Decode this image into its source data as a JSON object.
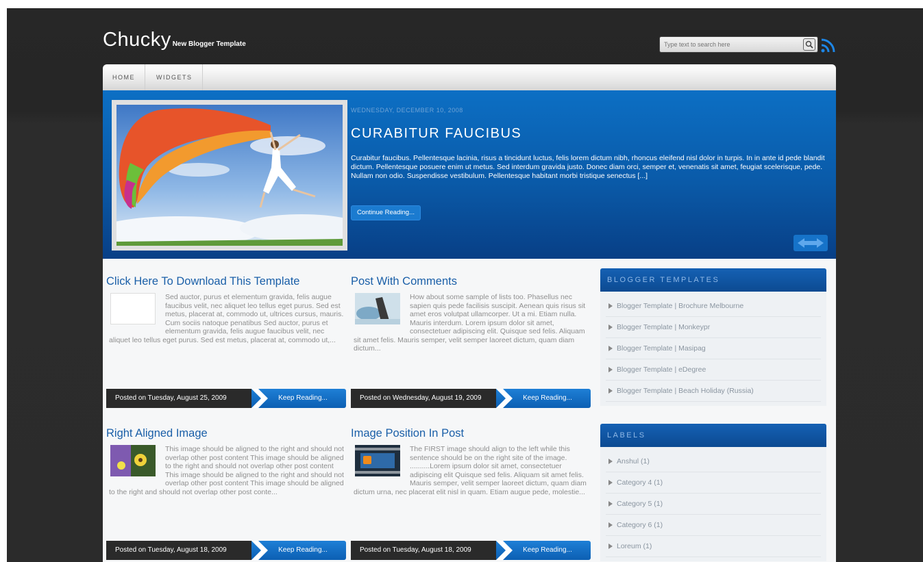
{
  "header": {
    "site_title": "Chucky",
    "tagline": "New Blogger Template",
    "search_placeholder": "Type text to search here",
    "rss_icon": "rss-icon"
  },
  "nav": {
    "items": [
      {
        "label": "HOME"
      },
      {
        "label": "WIDGETS"
      }
    ]
  },
  "featured": {
    "date": "WEDNESDAY, DECEMBER 10, 2008",
    "title": "CURABITUR FAUCIBUS",
    "text": "Curabitur faucibus. Pellentesque lacinia, risus a tincidunt luctus, felis lorem dictum nibh, rhoncus eleifend nisl dolor in turpis. In in ante id pede blandit dictum. Pellentesque posuere enim ut metus. Sed interdum gravida justo. Donec diam orci, semper et, venenatis sit amet, feugiat scelerisque, pede. Nullam non odio. Suspendisse vestibulum. Pellentesque habitant morbi tristique senectus [...]",
    "button": "Continue Reading...",
    "arrows_icon": "slider-arrows-icon",
    "colors": {
      "accent": "#0a5aa8",
      "title": "#ffffff"
    }
  },
  "posts": [
    {
      "title": "Click Here To Download This Template",
      "body": "Sed auctor, purus et elementum gravida, felis augue faucibus velit, nec aliquet leo tellus eget purus. Sed est metus, placerat at, commodo ut, ultrices cursus, mauris. Cum sociis natoque penatibus Sed auctor, purus et elementum gravida, felis augue faucibus velit, nec aliquet leo tellus eget purus. Sed est metus, placerat at, commodo ut,...",
      "meta": "Posted on Tuesday, August 25, 2009",
      "more": "Keep Reading..."
    },
    {
      "title": "Post With Comments",
      "body": "How about some sample of lists too. Phasellus nec sapien quis pede facilisis suscipit. Aenean quis risus sit amet eros volutpat ullamcorper. Ut a mi. Etiam nulla. Mauris interdum. Lorem ipsum dolor sit amet, consectetuer adipiscing elit. Quisque sed felis. Aliquam sit amet felis. Mauris semper, velit semper laoreet dictum, quam diam dictum...",
      "meta": "Posted on Wednesday, August 19, 2009",
      "more": "Keep Reading..."
    },
    {
      "title": "Right Aligned Image",
      "body": "This image should be aligned to the right and should not overlap other post content This image should be aligned to the right and should not overlap other post content This image should be aligned to the right and should not overlap other post content This image should be aligned to the right and should not overlap other post conte...",
      "meta": "Posted on Tuesday, August 18, 2009",
      "more": "Keep Reading..."
    },
    {
      "title": "Image Position In Post",
      "body": "The FIRST image should align to the left while this sentence should be on the right site of the image. ..........Lorem ipsum dolor sit amet, consectetuer adipiscing elit Quisque sed felis. Aliquam sit amet felis. Mauris semper, velit semper laoreet dictum, quam diam dictum urna, nec placerat elit nisl in quam. Etiam augue pede, molestie...",
      "meta": "Posted on Tuesday, August 18, 2009",
      "more": "Keep Reading..."
    }
  ],
  "sidebar": {
    "blogger_templates": {
      "title": "BLOGGER TEMPLATES",
      "items": [
        "Blogger Template | Brochure Melbourne",
        "Blogger Template | Monkeypr",
        "Blogger Template | Masipag",
        "Blogger Template | eDegree",
        "Blogger Template | Beach Holiday (Russia)"
      ]
    },
    "labels": {
      "title": "LABELS",
      "items": [
        "Anshul (1)",
        "Category 4 (1)",
        "Category 5 (1)",
        "Category 6 (1)",
        "Loreum (1)"
      ]
    }
  }
}
